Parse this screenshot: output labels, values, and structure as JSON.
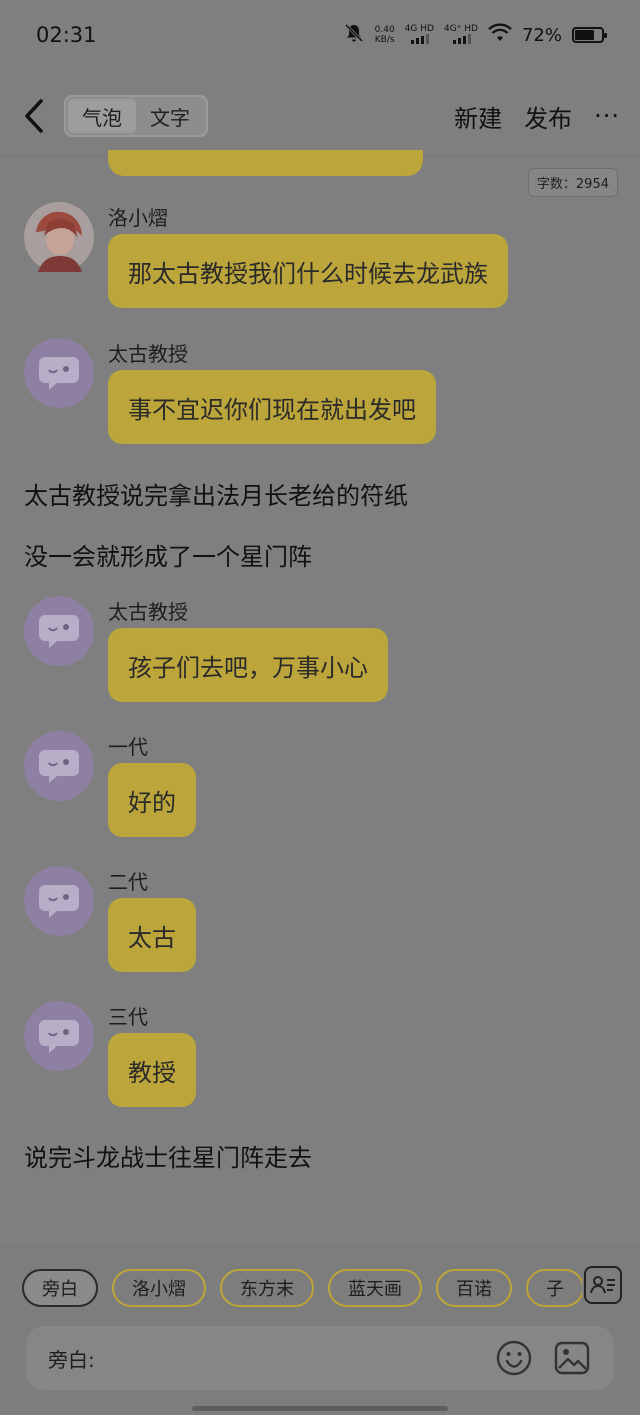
{
  "status": {
    "time": "02:31",
    "net_speed": "0.40",
    "net_unit": "KB/s",
    "sim1": "4G HD",
    "sim2": "4G⁺ HD",
    "battery": "72%",
    "battery_level": 0.72
  },
  "nav": {
    "tab_bubble": "气泡",
    "tab_text": "文字",
    "new_label": "新建",
    "publish_label": "发布",
    "more_label": "···"
  },
  "word_count": "字数：2954",
  "messages": [
    {
      "sender": "洛小熠",
      "text": "那太古教授我们什么时候去龙武族"
    },
    {
      "sender": "太古教授",
      "text": "事不宜迟你们现在就出发吧"
    },
    {
      "sender": "太古教授",
      "text": "孩子们去吧，万事小心"
    },
    {
      "sender": "一代",
      "text": "好的"
    },
    {
      "sender": "二代",
      "text": "太古"
    },
    {
      "sender": "三代",
      "text": "教授"
    }
  ],
  "narrations": [
    "太古教授说完拿出法月长老给的符纸",
    "没一会就形成了一个星门阵",
    "说完斗龙战士往星门阵走去"
  ],
  "chips": [
    "旁白",
    "洛小熠",
    "东方末",
    "蓝天画",
    "百诺",
    "子"
  ],
  "input": {
    "label": "旁白:",
    "value": "",
    "placeholder": ""
  },
  "colors": {
    "bubble": "#bca53b",
    "background": "#7f7f7f"
  }
}
